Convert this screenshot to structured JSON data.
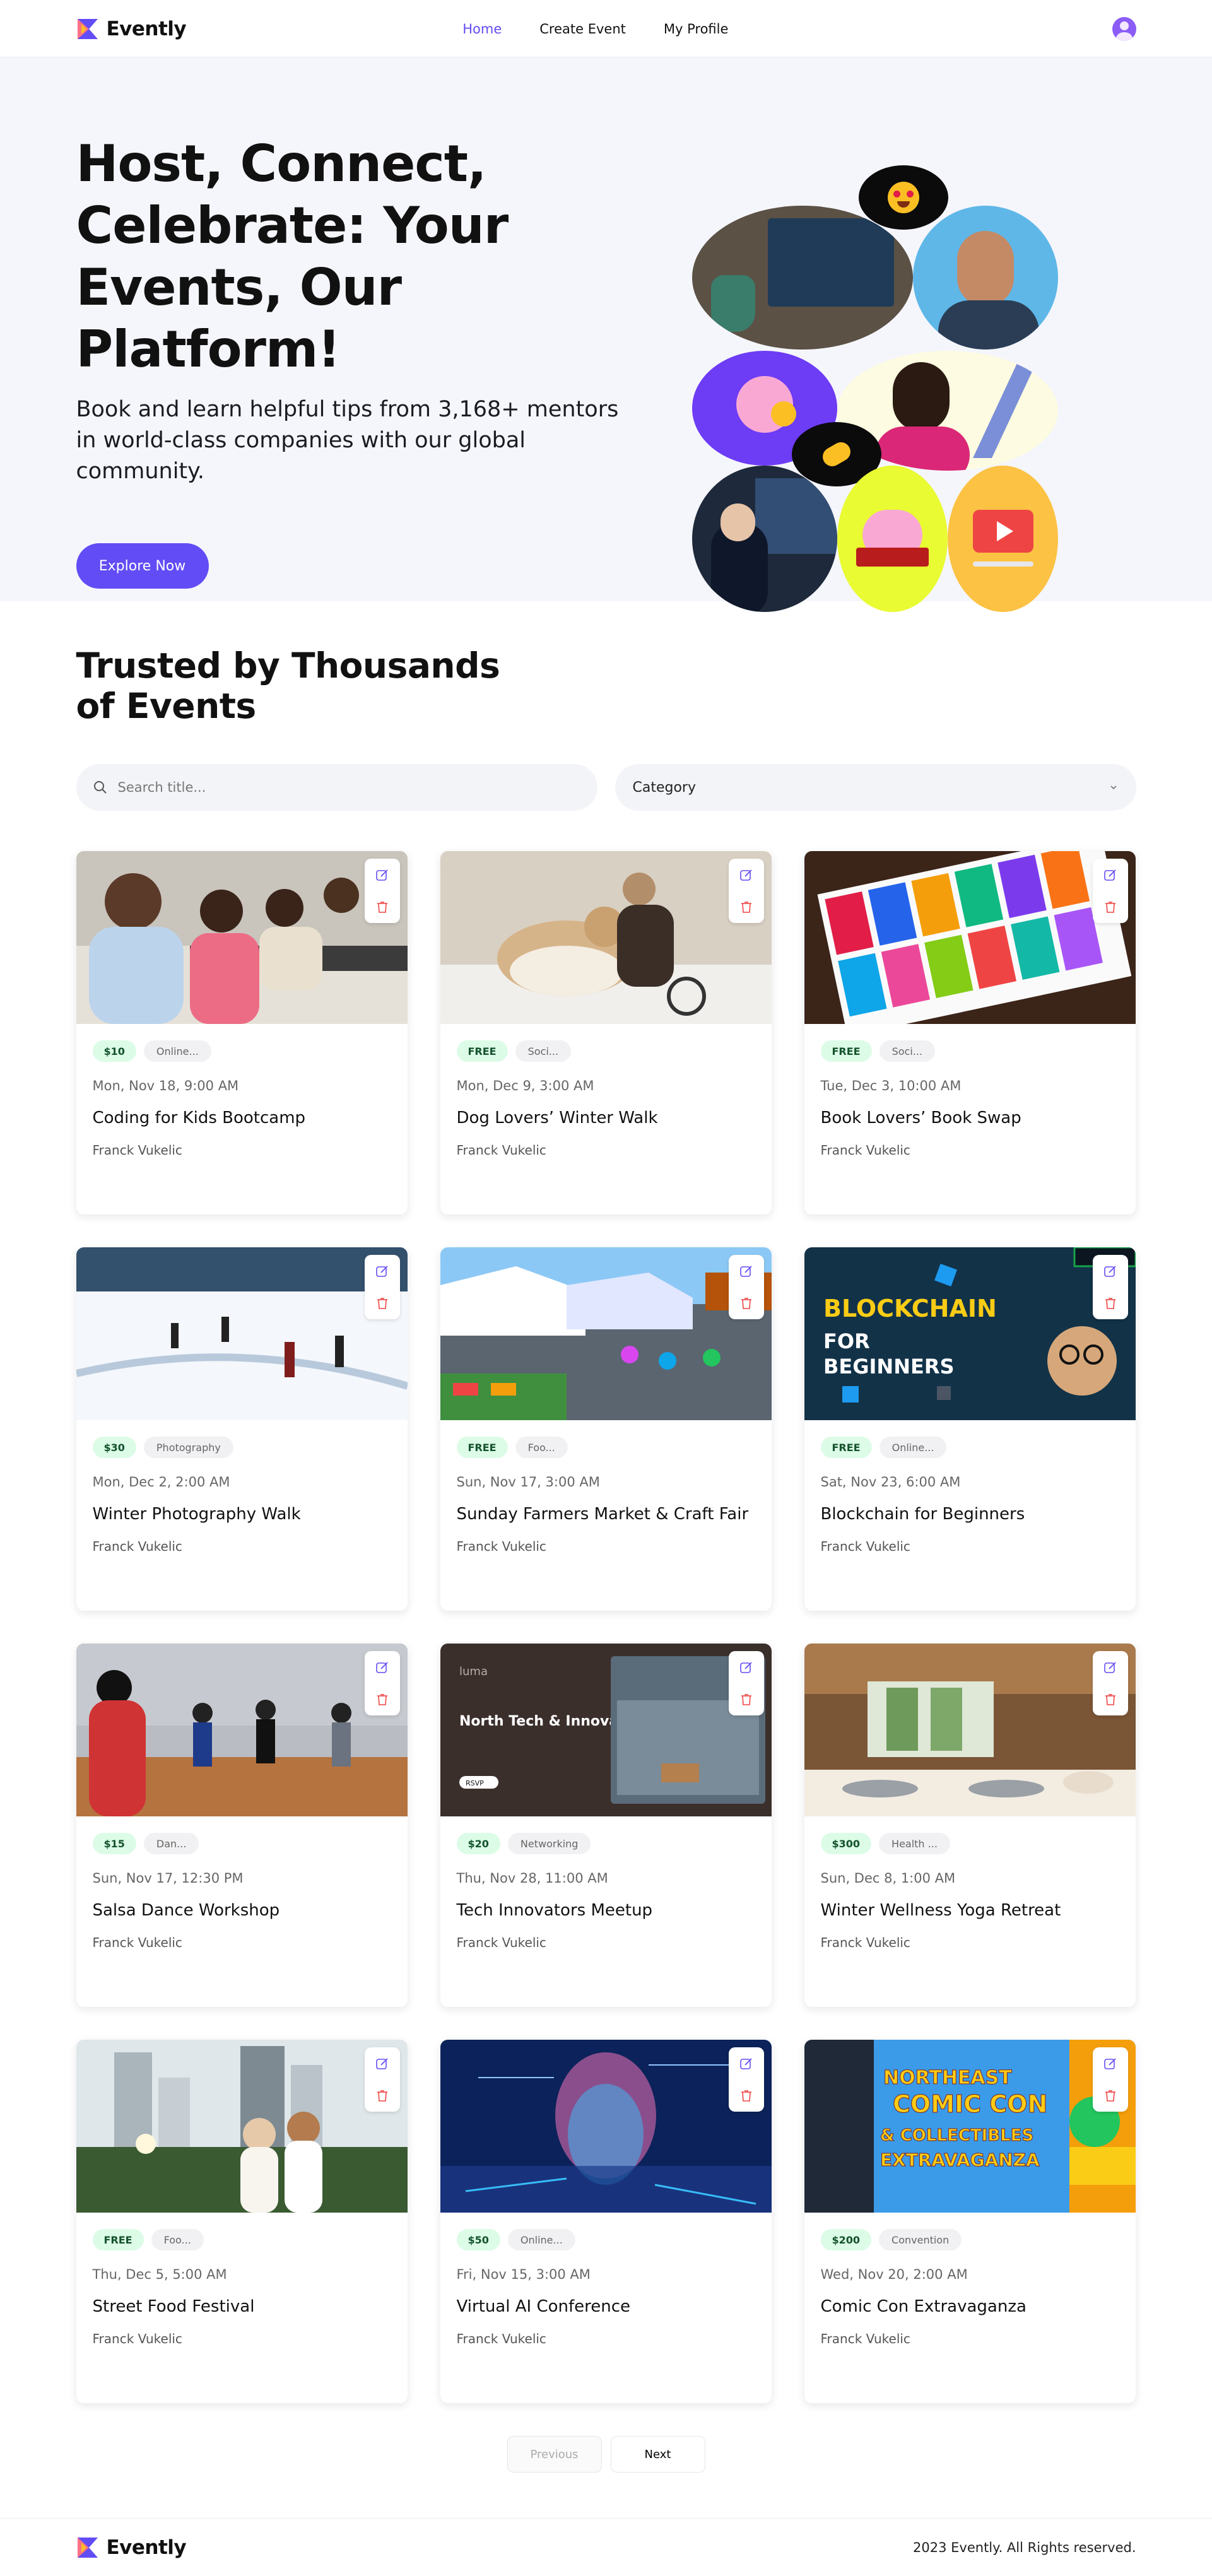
{
  "brand": {
    "name": "Evently"
  },
  "nav": {
    "home": "Home",
    "create": "Create Event",
    "profile": "My Profile"
  },
  "hero": {
    "title": "Host, Connect, Celebrate: Your Events, Our Platform!",
    "subtitle": "Book and learn helpful tips from 3,168+ mentors in world-class companies with our global community.",
    "cta": "Explore Now"
  },
  "section": {
    "title": "Trusted by Thousands of Events"
  },
  "filters": {
    "search_placeholder": "Search title...",
    "category_label": "Category"
  },
  "events": [
    {
      "price": "$10",
      "category": "Online...",
      "date": "Mon, Nov 18, 9:00 AM",
      "title": "Coding for Kids Bootcamp",
      "organizer": "Franck Vukelic"
    },
    {
      "price": "FREE",
      "category": "Soci...",
      "date": "Mon, Dec 9, 3:00 AM",
      "title": "Dog Lovers’ Winter Walk",
      "organizer": "Franck Vukelic"
    },
    {
      "price": "FREE",
      "category": "Soci...",
      "date": "Tue, Dec 3, 10:00 AM",
      "title": "Book Lovers’ Book Swap",
      "organizer": "Franck Vukelic"
    },
    {
      "price": "$30",
      "category": "Photography",
      "date": "Mon, Dec 2, 2:00 AM",
      "title": "Winter Photography Walk",
      "organizer": "Franck Vukelic"
    },
    {
      "price": "FREE",
      "category": "Foo...",
      "date": "Sun, Nov 17, 3:00 AM",
      "title": "Sunday Farmers Market & Craft Fair",
      "organizer": "Franck Vukelic"
    },
    {
      "price": "FREE",
      "category": "Online...",
      "date": "Sat, Nov 23, 6:00 AM",
      "title": "Blockchain for Beginners",
      "organizer": "Franck Vukelic"
    },
    {
      "price": "$15",
      "category": "Dan...",
      "date": "Sun, Nov 17, 12:30 PM",
      "title": "Salsa Dance Workshop",
      "organizer": "Franck Vukelic"
    },
    {
      "price": "$20",
      "category": "Networking",
      "date": "Thu, Nov 28, 11:00 AM",
      "title": "Tech Innovators Meetup",
      "organizer": "Franck Vukelic"
    },
    {
      "price": "$300",
      "category": "Health ...",
      "date": "Sun, Dec 8, 1:00 AM",
      "title": "Winter Wellness Yoga Retreat",
      "organizer": "Franck Vukelic"
    },
    {
      "price": "FREE",
      "category": "Foo...",
      "date": "Thu, Dec 5, 5:00 AM",
      "title": "Street Food Festival",
      "organizer": "Franck Vukelic"
    },
    {
      "price": "$50",
      "category": "Online...",
      "date": "Fri, Nov 15, 3:00 AM",
      "title": "Virtual AI Conference",
      "organizer": "Franck Vukelic"
    },
    {
      "price": "$200",
      "category": "Convention",
      "date": "Wed, Nov 20, 2:00 AM",
      "title": "Comic Con Extravaganza",
      "organizer": "Franck Vukelic"
    }
  ],
  "image_text": {
    "blockchain": "BLOCKCHAIN",
    "blockchain_sub1": "FOR",
    "blockchain_sub2": "BEGINNERS",
    "luma": "luma",
    "meetup_title": "North Tech & Innovation Meetup",
    "rsvp": "RSVP",
    "comic_1": "NORTHEAST",
    "comic_2": "COMIC CON",
    "comic_3": "& COLLECTIBLES",
    "comic_4": "EXTRAVAGANZA"
  },
  "pagination": {
    "previous": "Previous",
    "next": "Next"
  },
  "footer": {
    "copyright": "2023 Evently. All Rights reserved."
  },
  "colors": {
    "accent": "#624cf5",
    "price_bg": "#dcfce7",
    "hero_bg": "#f5f6fc"
  }
}
